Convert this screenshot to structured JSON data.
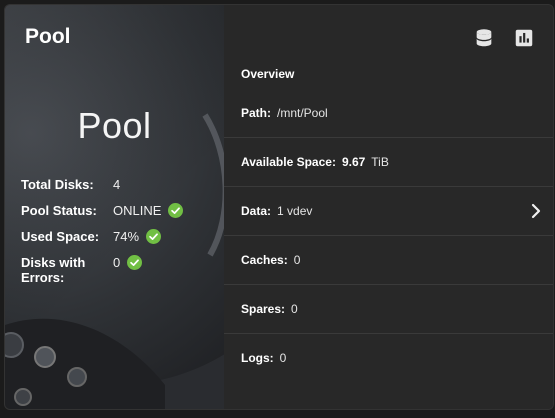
{
  "card": {
    "title": "Pool",
    "hero_name": "Pool",
    "stats": [
      {
        "label": "Total Disks:",
        "value": "4",
        "ok": false
      },
      {
        "label": "Pool Status:",
        "value": "ONLINE",
        "ok": true
      },
      {
        "label": "Used Space:",
        "value": "74%",
        "ok": true
      },
      {
        "label": "Disks with Errors:",
        "value": "0",
        "ok": true
      }
    ]
  },
  "overview": {
    "title": "Overview",
    "path_label": "Path:",
    "path_value": "/mnt/Pool",
    "available_label": "Available Space:",
    "available_value": "9.67",
    "available_unit": "TiB",
    "data_label": "Data:",
    "data_value": "1 vdev",
    "caches_label": "Caches:",
    "caches_value": "0",
    "spares_label": "Spares:",
    "spares_value": "0",
    "logs_label": "Logs:",
    "logs_value": "0"
  },
  "icons": {
    "toolbar": [
      "database-icon",
      "bar-chart-icon"
    ],
    "status_ok": "check-circle-icon",
    "expand": "chevron-right-icon"
  },
  "colors": {
    "ok_green": "#71bf44",
    "panel_bg": "#282828",
    "divider": "#3a3a3a"
  }
}
